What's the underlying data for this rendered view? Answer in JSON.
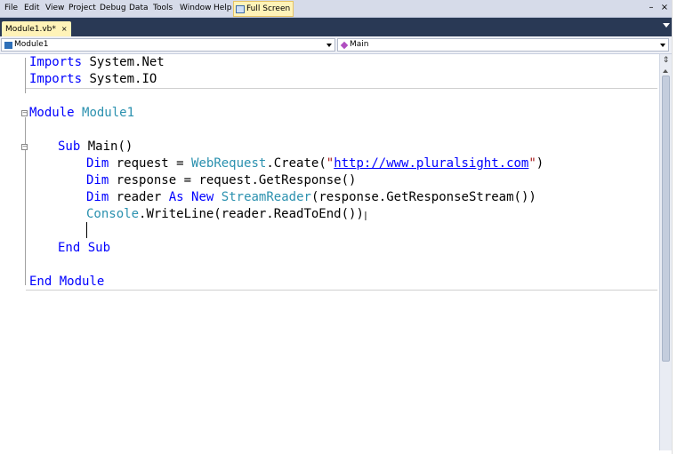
{
  "menu": {
    "items": [
      "File",
      "Edit",
      "View",
      "Project",
      "Debug",
      "Data",
      "Tools",
      "Window",
      "Help"
    ],
    "fullscreen_label": "Full Screen",
    "minimize": "–",
    "close": "×"
  },
  "tab": {
    "label": "Module1.vb*",
    "close": "×"
  },
  "navbar": {
    "left_selected": "Module1",
    "right_selected": "Main"
  },
  "code": {
    "imports_kw": "Imports",
    "import1": "System.Net",
    "import2": "System.IO",
    "module_kw": "Module",
    "module_name": "Module1",
    "sub_kw": "Sub",
    "sub_name": "Main()",
    "dim_kw": "Dim",
    "line1_var": "request = ",
    "line1_type": "WebRequest",
    "line1_rest": ".Create(",
    "line1_q1": "\"",
    "line1_url": "http://www.pluralsight.com",
    "line1_q2": "\"",
    "line1_end": ")",
    "line2_rest": "response = request.GetResponse()",
    "line3_var": "reader ",
    "as_kw": "As",
    "new_kw": "New",
    "line3_type": "StreamReader",
    "line3_rest": "(response.GetResponseStream())",
    "line4_type": "Console",
    "line4_rest": ".WriteLine(reader.ReadToEnd())",
    "end_kw": "End",
    "end_sub_kw": "Sub",
    "end_module_kw": "Module"
  },
  "colors": {
    "keyword": "#0000ff",
    "type": "#2b91af",
    "string": "#a31515",
    "tab_active": "#fff3b8",
    "tabstrip": "#293955"
  }
}
